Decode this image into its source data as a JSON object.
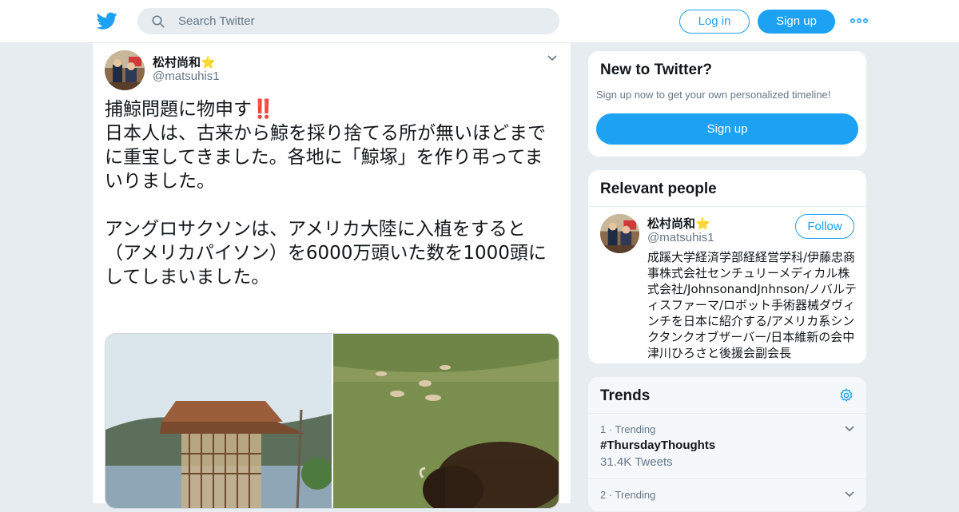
{
  "header": {
    "search_placeholder": "Search Twitter",
    "login_label": "Log in",
    "signup_label": "Sign up"
  },
  "tweet": {
    "author_name": "松村尚和⭐",
    "author_handle": "@matsuhis1",
    "text_line1": "捕鯨問題に物申す",
    "text_line1_emoji": "‼️",
    "text_body": "\n日本人は、古来から鯨を採り捨てる所が無いほどまでに重宝してきました。各地に「鯨塚」を作り弔ってまいりました。\n\nアングロサクソンは、アメリカ大陸に入植をすると（アメリカパイソン）を6000万頭いた数を1000頭にしてしまいました。"
  },
  "new_to_twitter": {
    "title": "New to Twitter?",
    "subtitle": "Sign up now to get your own personalized timeline!",
    "button_label": "Sign up"
  },
  "relevant_people": {
    "title": "Relevant people",
    "person": {
      "name": "松村尚和⭐",
      "handle": "@matsuhis1",
      "follow_label": "Follow",
      "bio": "成蹊大学経済学部経経営学科/伊藤忠商事株式会社センチュリーメディカル株式会社/JohnsonandJnhnson/ノバルティスファーマ/ロボット手術器械ダヴィンチを日本に紹介する/アメリカ系シンクタンクオブザーバー/日本維新の会中津川ひろさと後援会副会長"
    }
  },
  "trends": {
    "title": "Trends",
    "items": [
      {
        "rank": "1 · Trending",
        "name": "#ThursdayThoughts",
        "count": "31.4K Tweets"
      },
      {
        "rank": "2 · Trending",
        "name": "",
        "count": ""
      }
    ]
  },
  "colors": {
    "accent": "#1da1f2",
    "background": "#e6ecf0",
    "text_secondary": "#657786"
  }
}
